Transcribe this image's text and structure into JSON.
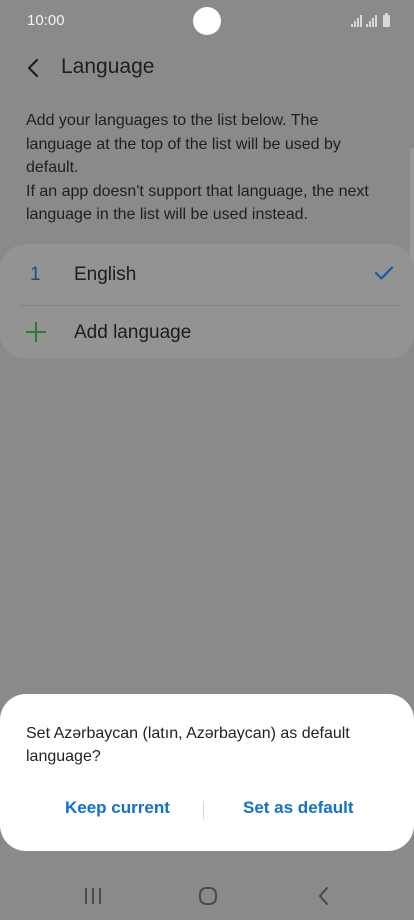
{
  "status_bar": {
    "time": "10:00"
  },
  "app_bar": {
    "title": "Language"
  },
  "description": {
    "line1": "Add your languages to the list below. The language at the top of the list will be used by default.",
    "line2": "If an app doesn't support that language, the next language in the list will be used instead."
  },
  "languages": [
    {
      "index": "1",
      "name": "English",
      "selected": true
    }
  ],
  "add_language_label": "Add language",
  "dialog": {
    "message": "Set Azərbaycan (latın, Azərbaycan) as default language?",
    "keep_label": "Keep current",
    "default_label": "Set as default"
  },
  "colors": {
    "accent": "#1470c4",
    "plus": "#2e8b3c",
    "overlay": "#8a8a8a"
  },
  "icons": [
    "back-arrow-icon",
    "check-icon",
    "plus-icon",
    "recents-icon",
    "home-icon",
    "nav-back-icon"
  ]
}
